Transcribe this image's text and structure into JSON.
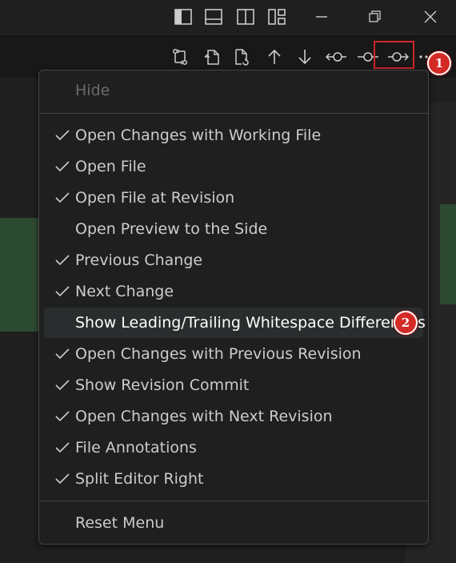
{
  "menu": {
    "items": [
      {
        "label": "Hide",
        "checked": false,
        "disabled": true
      },
      {
        "label": "Open Changes with Working File",
        "checked": true
      },
      {
        "label": "Open File",
        "checked": true
      },
      {
        "label": "Open File at Revision",
        "checked": true
      },
      {
        "label": "Open Preview to the Side",
        "checked": false
      },
      {
        "label": "Previous Change",
        "checked": true
      },
      {
        "label": "Next Change",
        "checked": true
      },
      {
        "label": "Show Leading/Trailing Whitespace Differences",
        "checked": false,
        "selected": true
      },
      {
        "label": "Open Changes with Previous Revision",
        "checked": true
      },
      {
        "label": "Show Revision Commit",
        "checked": true
      },
      {
        "label": "Open Changes with Next Revision",
        "checked": true
      },
      {
        "label": "File Annotations",
        "checked": true
      },
      {
        "label": "Split Editor Right",
        "checked": true
      },
      {
        "label": "Reset Menu",
        "checked": false
      }
    ]
  },
  "badges": {
    "first": "1",
    "second": "2"
  },
  "titlebar_icons": [
    "toggle-primary-sidebar-icon",
    "toggle-panel-icon",
    "toggle-secondary-sidebar-icon",
    "customize-layout-icon",
    "minimize-icon",
    "restore-icon",
    "close-icon"
  ],
  "toolbar_icons": [
    "compare-changes-icon",
    "open-file-icon",
    "open-file-at-revision-icon",
    "previous-change-icon",
    "next-change-icon",
    "open-changes-previous-revision-icon",
    "show-revision-commit-icon",
    "open-changes-next-revision-icon",
    "more-actions-icon"
  ],
  "colors": {
    "accent_red": "#d42a26",
    "menu_bg": "#1f1f1f",
    "diff_green": "#2d4a32"
  }
}
